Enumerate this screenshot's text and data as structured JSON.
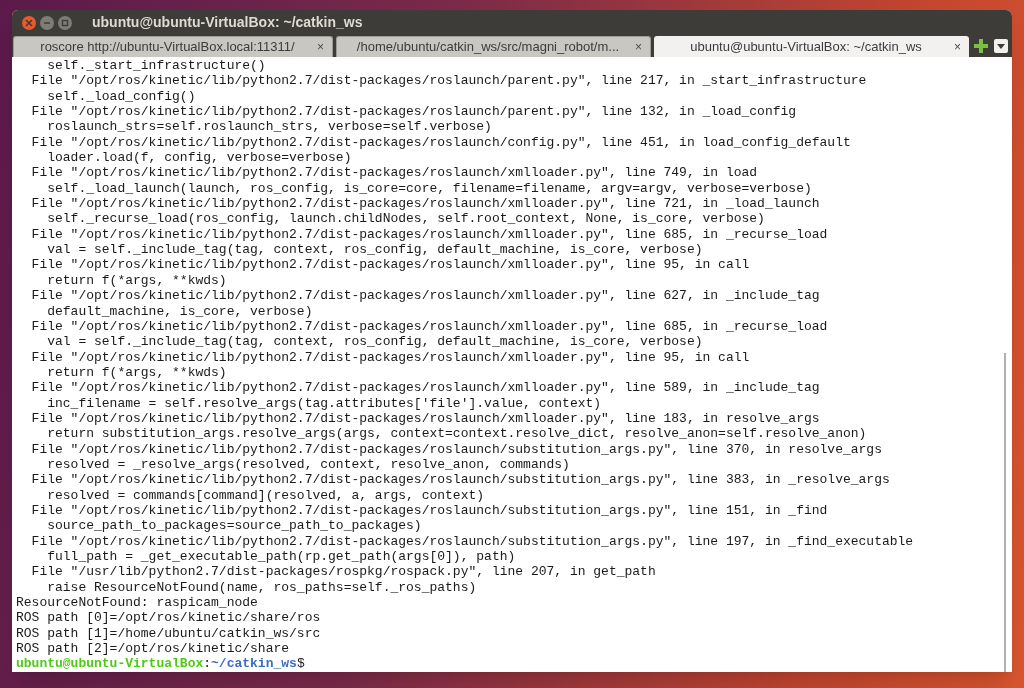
{
  "window": {
    "title": "ubuntu@ubuntu-VirtualBox: ~/catkin_ws"
  },
  "tabs": [
    {
      "label": "roscore http://ubuntu-VirtualBox.local:11311/",
      "selected": false,
      "close": "×"
    },
    {
      "label": "/home/ubuntu/catkin_ws/src/magni_robot/m...",
      "selected": false,
      "close": "×"
    },
    {
      "label": "ubuntu@ubuntu-VirtualBox: ~/catkin_ws",
      "selected": true,
      "close": "×"
    }
  ],
  "terminal": {
    "lines": [
      "    self._start_infrastructure()",
      "  File \"/opt/ros/kinetic/lib/python2.7/dist-packages/roslaunch/parent.py\", line 217, in _start_infrastructure",
      "    self._load_config()",
      "  File \"/opt/ros/kinetic/lib/python2.7/dist-packages/roslaunch/parent.py\", line 132, in _load_config",
      "    roslaunch_strs=self.roslaunch_strs, verbose=self.verbose)",
      "  File \"/opt/ros/kinetic/lib/python2.7/dist-packages/roslaunch/config.py\", line 451, in load_config_default",
      "    loader.load(f, config, verbose=verbose)",
      "  File \"/opt/ros/kinetic/lib/python2.7/dist-packages/roslaunch/xmlloader.py\", line 749, in load",
      "    self._load_launch(launch, ros_config, is_core=core, filename=filename, argv=argv, verbose=verbose)",
      "  File \"/opt/ros/kinetic/lib/python2.7/dist-packages/roslaunch/xmlloader.py\", line 721, in _load_launch",
      "    self._recurse_load(ros_config, launch.childNodes, self.root_context, None, is_core, verbose)",
      "  File \"/opt/ros/kinetic/lib/python2.7/dist-packages/roslaunch/xmlloader.py\", line 685, in _recurse_load",
      "    val = self._include_tag(tag, context, ros_config, default_machine, is_core, verbose)",
      "  File \"/opt/ros/kinetic/lib/python2.7/dist-packages/roslaunch/xmlloader.py\", line 95, in call",
      "    return f(*args, **kwds)",
      "  File \"/opt/ros/kinetic/lib/python2.7/dist-packages/roslaunch/xmlloader.py\", line 627, in _include_tag",
      "    default_machine, is_core, verbose)",
      "  File \"/opt/ros/kinetic/lib/python2.7/dist-packages/roslaunch/xmlloader.py\", line 685, in _recurse_load",
      "    val = self._include_tag(tag, context, ros_config, default_machine, is_core, verbose)",
      "  File \"/opt/ros/kinetic/lib/python2.7/dist-packages/roslaunch/xmlloader.py\", line 95, in call",
      "    return f(*args, **kwds)",
      "  File \"/opt/ros/kinetic/lib/python2.7/dist-packages/roslaunch/xmlloader.py\", line 589, in _include_tag",
      "    inc_filename = self.resolve_args(tag.attributes['file'].value, context)",
      "  File \"/opt/ros/kinetic/lib/python2.7/dist-packages/roslaunch/xmlloader.py\", line 183, in resolve_args",
      "    return substitution_args.resolve_args(args, context=context.resolve_dict, resolve_anon=self.resolve_anon)",
      "  File \"/opt/ros/kinetic/lib/python2.7/dist-packages/roslaunch/substitution_args.py\", line 370, in resolve_args",
      "    resolved = _resolve_args(resolved, context, resolve_anon, commands)",
      "  File \"/opt/ros/kinetic/lib/python2.7/dist-packages/roslaunch/substitution_args.py\", line 383, in _resolve_args",
      "    resolved = commands[command](resolved, a, args, context)",
      "  File \"/opt/ros/kinetic/lib/python2.7/dist-packages/roslaunch/substitution_args.py\", line 151, in _find",
      "    source_path_to_packages=source_path_to_packages)",
      "  File \"/opt/ros/kinetic/lib/python2.7/dist-packages/roslaunch/substitution_args.py\", line 197, in _find_executable",
      "    full_path = _get_executable_path(rp.get_path(args[0]), path)",
      "  File \"/usr/lib/python2.7/dist-packages/rospkg/rospack.py\", line 207, in get_path",
      "    raise ResourceNotFound(name, ros_paths=self._ros_paths)",
      "ResourceNotFound: raspicam_node",
      "ROS path [0]=/opt/ros/kinetic/share/ros",
      "ROS path [1]=/home/ubuntu/catkin_ws/src",
      "ROS path [2]=/opt/ros/kinetic/share"
    ],
    "prompt": {
      "user_host": "ubuntu@ubuntu-VirtualBox",
      "separator": ":",
      "path": "~/catkin_ws",
      "symbol": "$"
    }
  }
}
